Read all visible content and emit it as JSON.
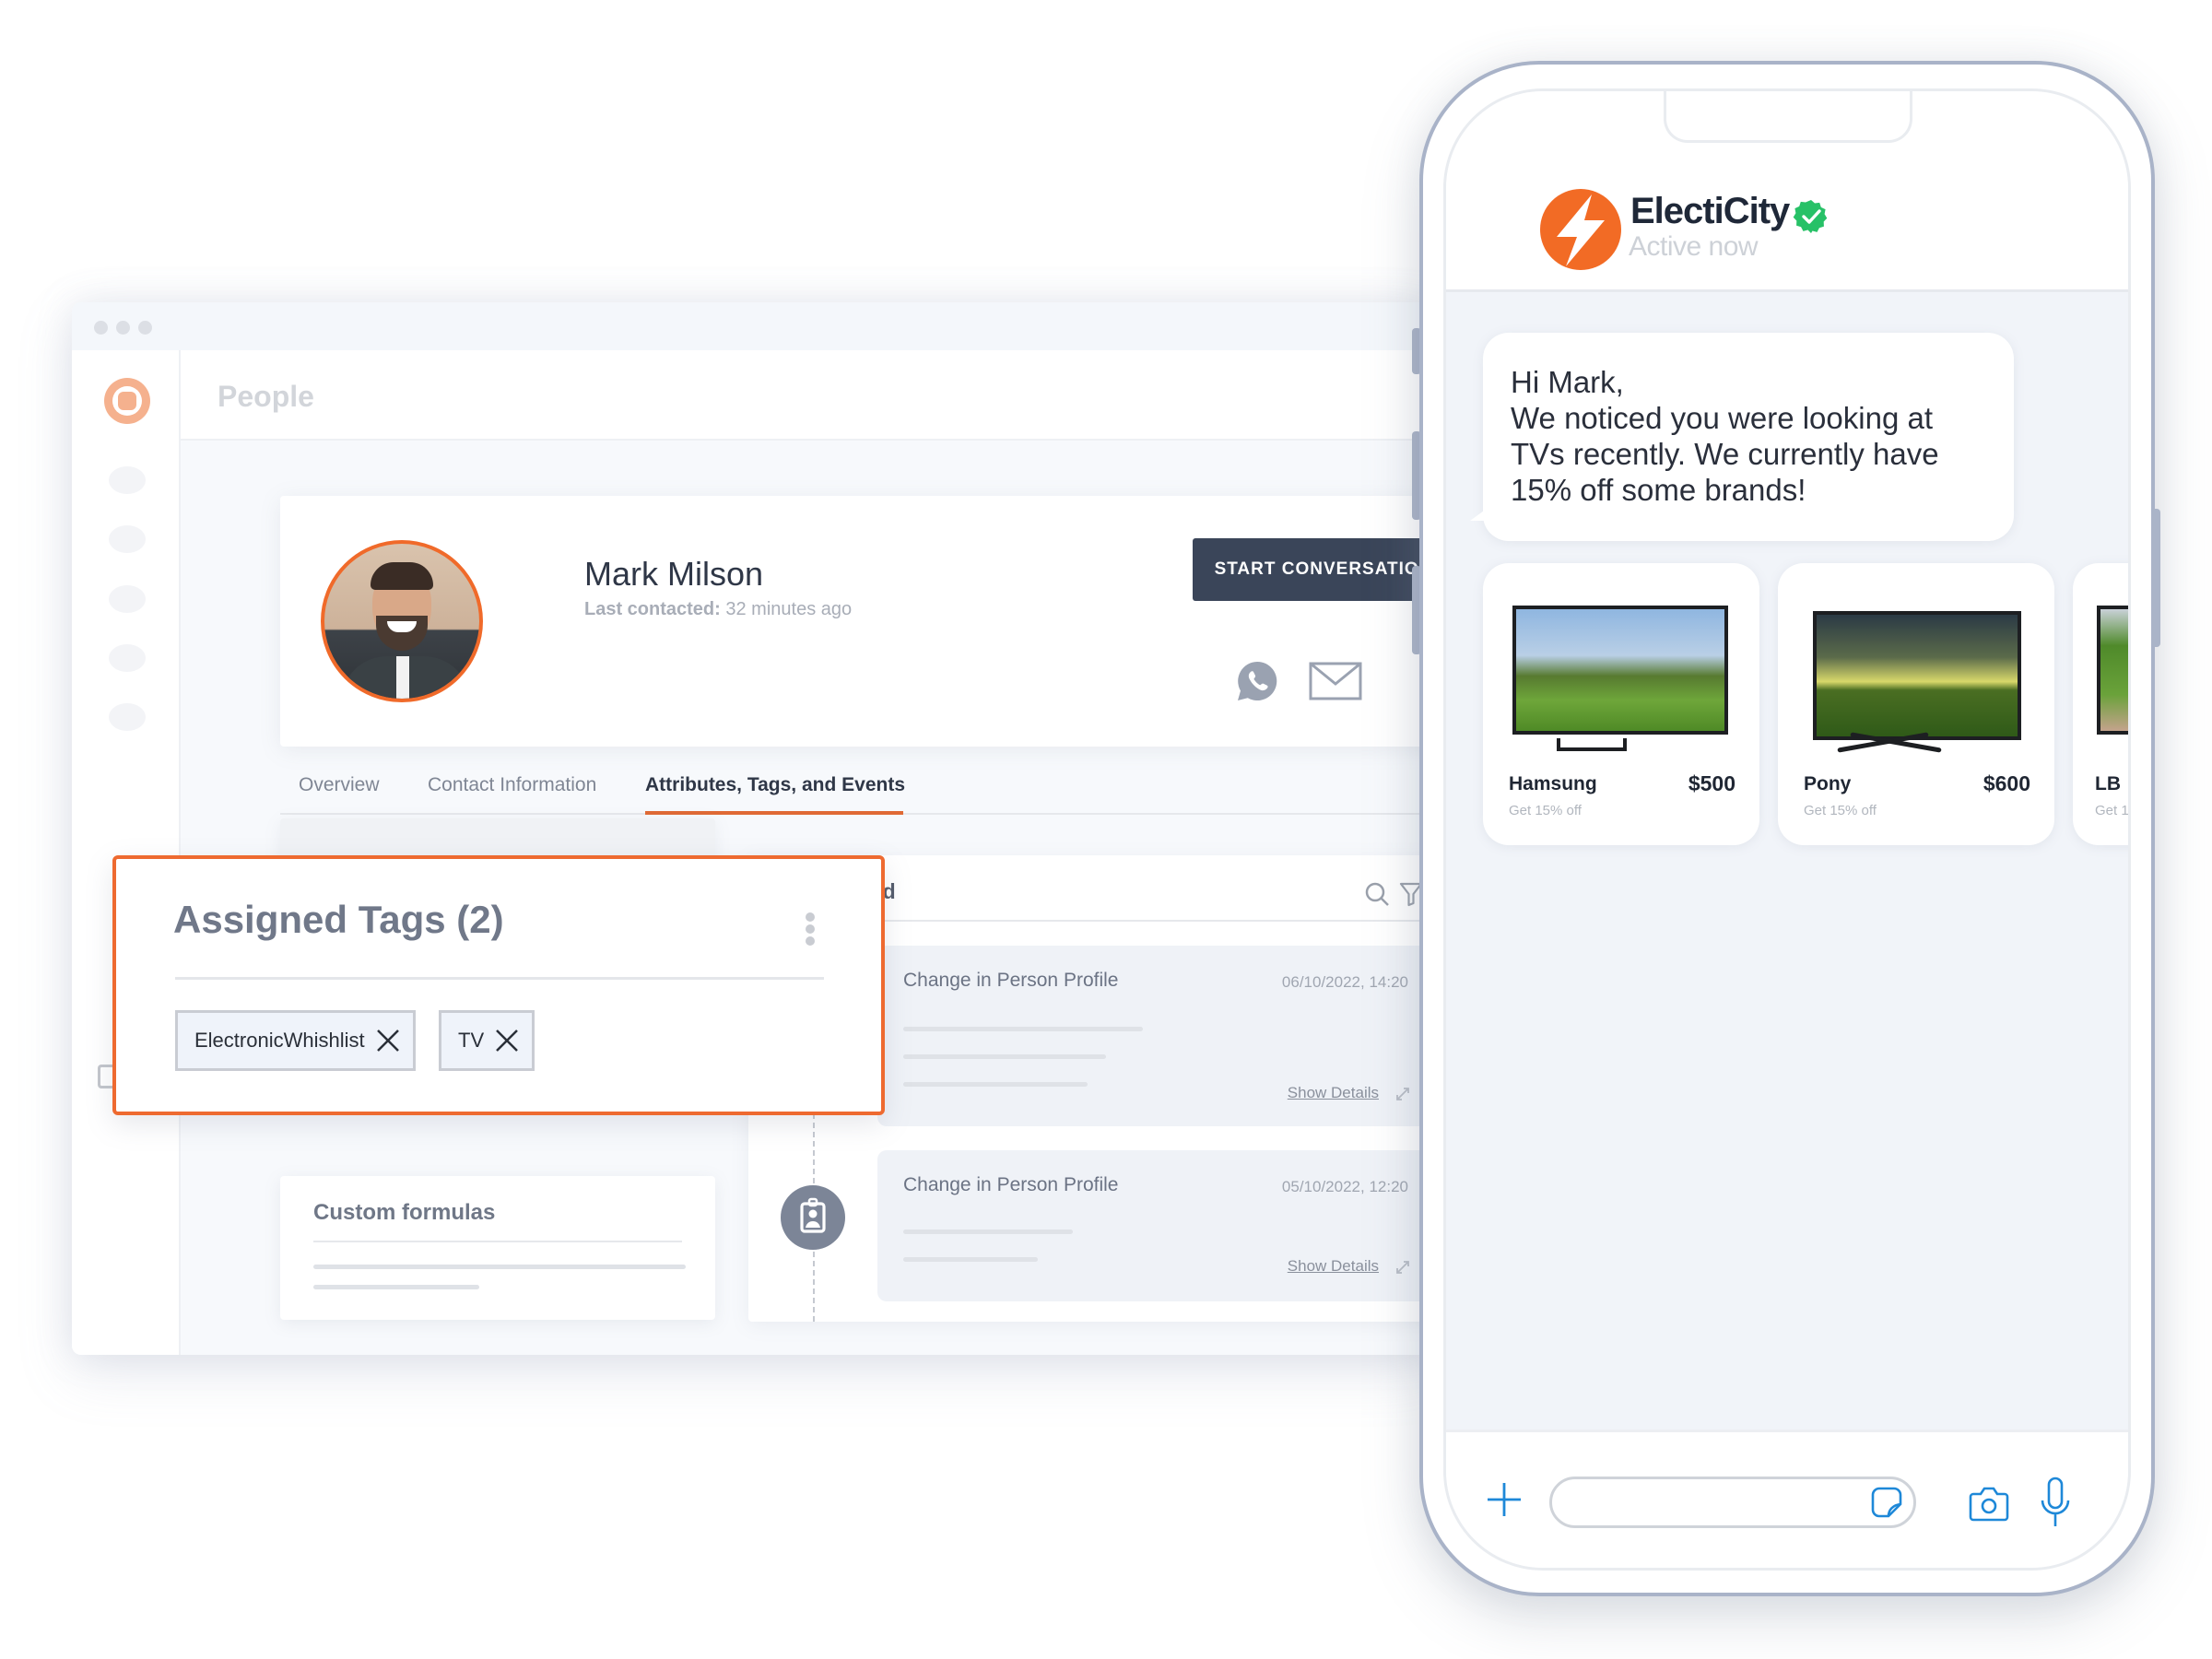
{
  "window": {
    "page_title": "People"
  },
  "profile": {
    "name": "Mark Milson",
    "last_contacted_label": "Last contacted:",
    "last_contacted_value": "32 minutes ago",
    "start_conversation_label": "START CONVERSATION",
    "channels": [
      "whatsapp-icon",
      "mail-icon"
    ]
  },
  "tabs": [
    {
      "label": "Overview",
      "active": false
    },
    {
      "label": "Contact Information",
      "active": false
    },
    {
      "label": "Attributes, Tags, and Events",
      "active": true
    }
  ],
  "assigned_tags": {
    "title": "Assigned Tags (2)",
    "tags": [
      {
        "label": "ElectronicWhishlist"
      },
      {
        "label": "TV"
      }
    ]
  },
  "custom_formulas": {
    "title": "Custom formulas"
  },
  "feed": {
    "title_visible": "eed",
    "events": [
      {
        "title": "Change in Person Profile",
        "date": "06/10/2022, 14:20",
        "action": "Show Details"
      },
      {
        "title": "Change in Person Profile",
        "date": "05/10/2022, 12:20",
        "action": "Show Details"
      }
    ]
  },
  "phone": {
    "brand_name": "ElectiCity",
    "status": "Active now",
    "verified": true,
    "message": "Hi Mark,\nWe noticed you were looking at\nTVs recently. We currently have\n15% off some brands!",
    "products": [
      {
        "name": "Hamsung",
        "price": "$500",
        "promo": "Get 15% off"
      },
      {
        "name": "Pony",
        "price": "$600",
        "promo": "Get 15% off"
      },
      {
        "name": "LB",
        "price": "",
        "promo": "Get 1"
      }
    ],
    "composer": {
      "input_value": "",
      "input_placeholder": ""
    }
  },
  "colors": {
    "accent_orange": "#EE6A30",
    "button_dark": "#3A4559",
    "brand_orange": "#F26B25",
    "verified_green": "#27C167",
    "icon_blue": "#1E88D8"
  }
}
